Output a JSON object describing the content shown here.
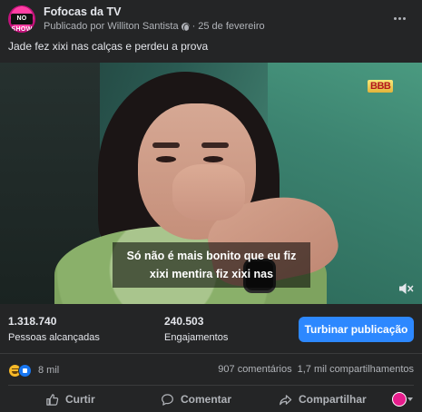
{
  "header": {
    "page_name": "Fofocas da TV",
    "avatar_label": "NO SHOW",
    "published_by": "Publicado por Williton Santista",
    "separator": "·",
    "date": "25 de fevereiro",
    "more_icon": "more-horizontal-icon"
  },
  "post": {
    "caption": "Jade fez xixi nas calças e perdeu a prova"
  },
  "video": {
    "logo": "BBB",
    "subtitle_line1": "Só não é mais bonito que eu fiz",
    "subtitle_line2": "xixi mentira fiz xixi nas",
    "sound_icon": "speaker-muted-icon"
  },
  "insights": {
    "reach_value": "1.318.740",
    "reach_label": "Pessoas alcançadas",
    "engagement_value": "240.503",
    "engagement_label": "Engajamentos",
    "boost_label": "Turbinar publicação"
  },
  "reactions": {
    "icons": [
      "haha-reaction-icon",
      "like-reaction-icon"
    ],
    "count": "8 mil",
    "comments": "907 comentários",
    "shares": "1,7 mil compartilhamentos"
  },
  "actions": {
    "like_label": "Curtir",
    "comment_label": "Comentar",
    "share_label": "Compartilhar"
  },
  "colors": {
    "background": "#242526",
    "primary_text": "#e4e6eb",
    "secondary_text": "#b0b3b8",
    "accent": "#2d88ff"
  }
}
